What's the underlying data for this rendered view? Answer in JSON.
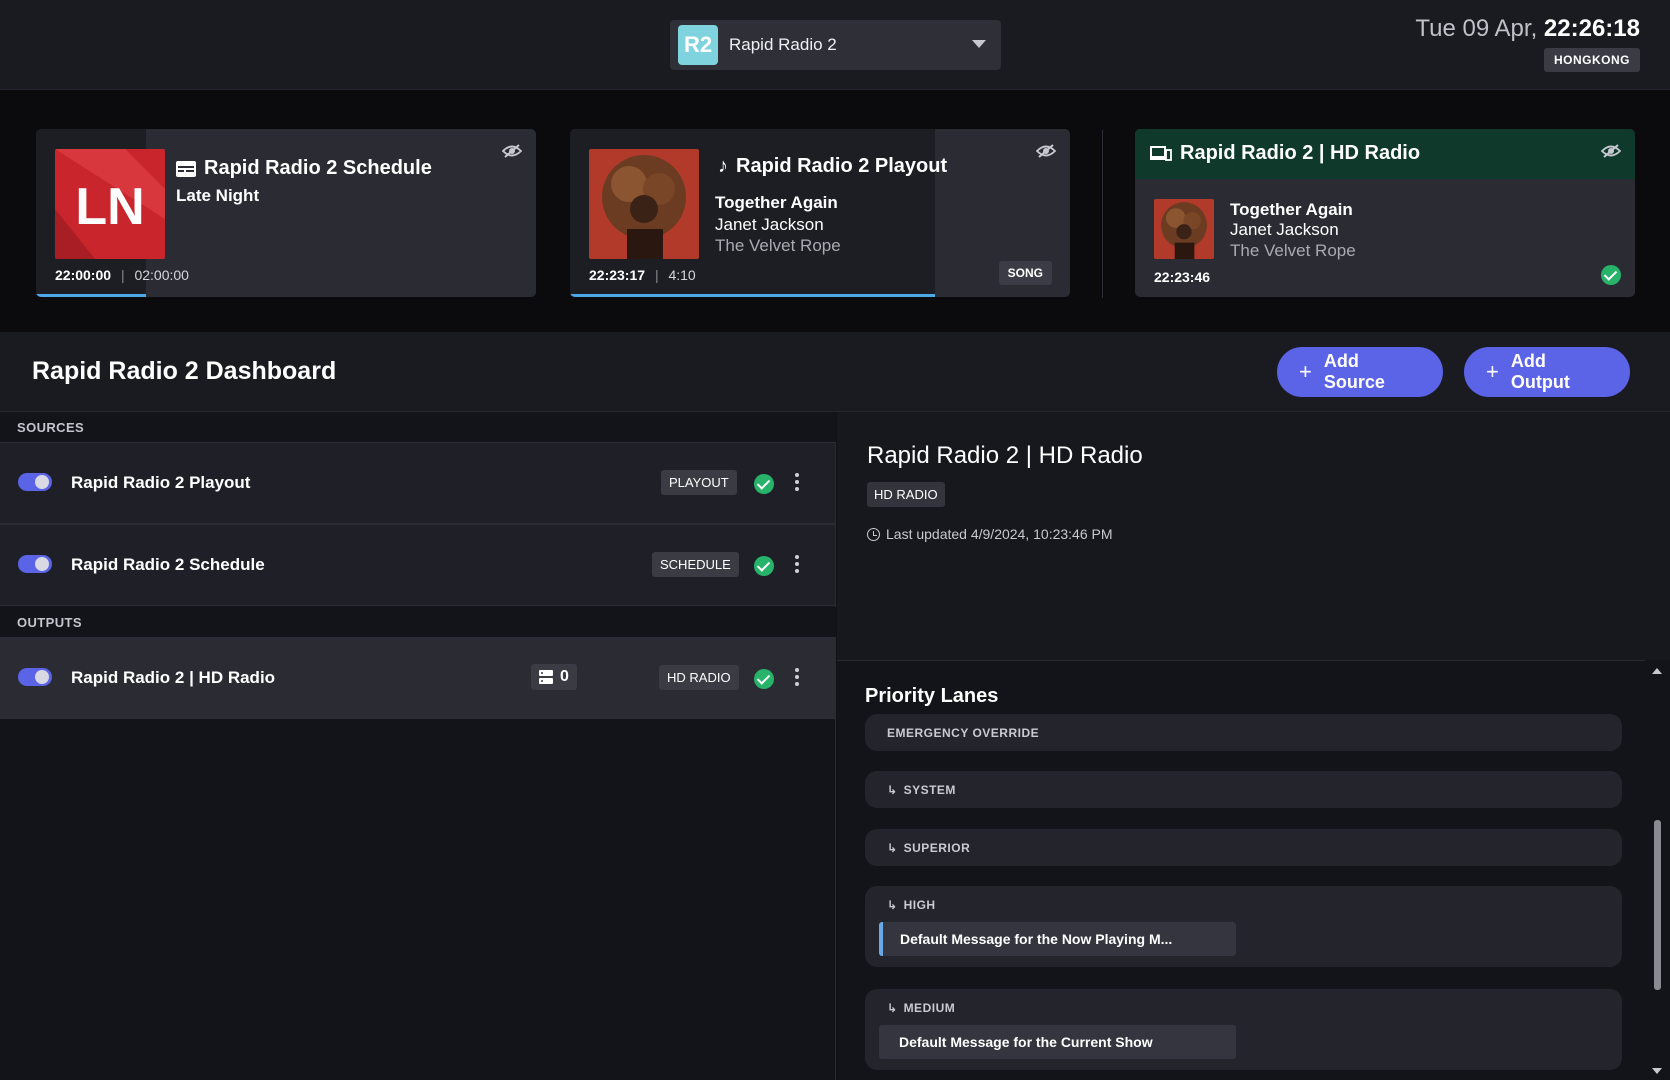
{
  "header": {
    "station_logo": "R2",
    "station_name": "Rapid Radio 2",
    "date": "Tue 09 Apr,",
    "time": "22:26:18",
    "timezone": "HONGKONG"
  },
  "cards": {
    "schedule": {
      "title": "Rapid Radio 2 Schedule",
      "show": "Late Night",
      "logo_text": "LN",
      "start": "22:00:00",
      "end": "02:00:00",
      "progress": 0.22
    },
    "playout": {
      "title": "Rapid Radio 2 Playout",
      "track": "Together Again",
      "artist": "Janet Jackson",
      "album": "The Velvet Rope",
      "start": "22:23:17",
      "duration": "4:10",
      "badge": "SONG",
      "progress": 0.73
    },
    "hd_radio": {
      "title": "Rapid Radio 2 | HD Radio",
      "track": "Together Again",
      "artist": "Janet Jackson",
      "album": "The Velvet Rope",
      "time": "22:23:46"
    }
  },
  "dashboard": {
    "title": "Rapid Radio 2 Dashboard",
    "add_source": "Add Source",
    "add_output": "Add Output",
    "plus": "+"
  },
  "sources": {
    "label": "SOURCES",
    "items": [
      {
        "name": "Rapid Radio 2 Playout",
        "type": "PLAYOUT"
      },
      {
        "name": "Rapid Radio 2 Schedule",
        "type": "SCHEDULE"
      }
    ]
  },
  "outputs": {
    "label": "OUTPUTS",
    "items": [
      {
        "name": "Rapid Radio 2 | HD Radio",
        "type": "HD RADIO",
        "count": "0"
      }
    ]
  },
  "detail": {
    "title": "Rapid Radio 2 | HD Radio",
    "badge": "HD RADIO",
    "updated": "Last updated 4/9/2024, 10:23:46 PM"
  },
  "priority_lanes": {
    "title": "Priority Lanes",
    "arrow": "↳",
    "lanes": [
      {
        "label": "EMERGENCY OVERRIDE"
      },
      {
        "label": "SYSTEM"
      },
      {
        "label": "SUPERIOR"
      },
      {
        "label": "HIGH",
        "message": "Default Message for the Now Playing M..."
      },
      {
        "label": "MEDIUM",
        "message": "Default Message for the Current Show"
      }
    ]
  },
  "colors": {
    "accent": "#5b63e6",
    "ok": "#27b36a",
    "progress": "#4da8e8",
    "hd_header": "#0f3a2b"
  }
}
